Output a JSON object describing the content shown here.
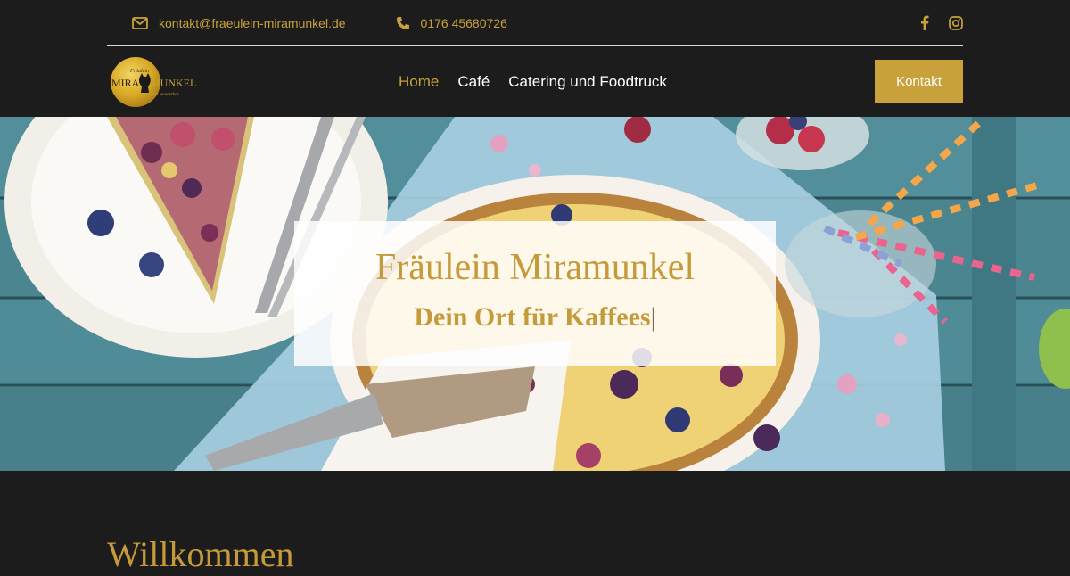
{
  "topbar": {
    "email": "kontakt@fraeulein-miramunkel.de",
    "phone": "0176 45680726"
  },
  "logo": {
    "brand_prefix": "Fräulein",
    "brand_main_left": "MIRA",
    "brand_main_right": "MUNKEL",
    "tagline": "alles wunderbar."
  },
  "nav": {
    "items": [
      "Home",
      "Café",
      "Catering und Foodtruck"
    ],
    "active_index": 0,
    "cta_label": "Kontakt"
  },
  "hero": {
    "title": "Fräulein Miramunkel",
    "subtitle": "Dein Ort für Kaffees",
    "cursor": "|"
  },
  "welcome": {
    "heading": "Willkommen"
  },
  "colors": {
    "background": "#1c1c1c",
    "accent": "#c9a13b",
    "hero_text": "#c59a3a"
  },
  "icons": [
    "envelope-icon",
    "phone-icon",
    "facebook-icon",
    "instagram-icon"
  ]
}
